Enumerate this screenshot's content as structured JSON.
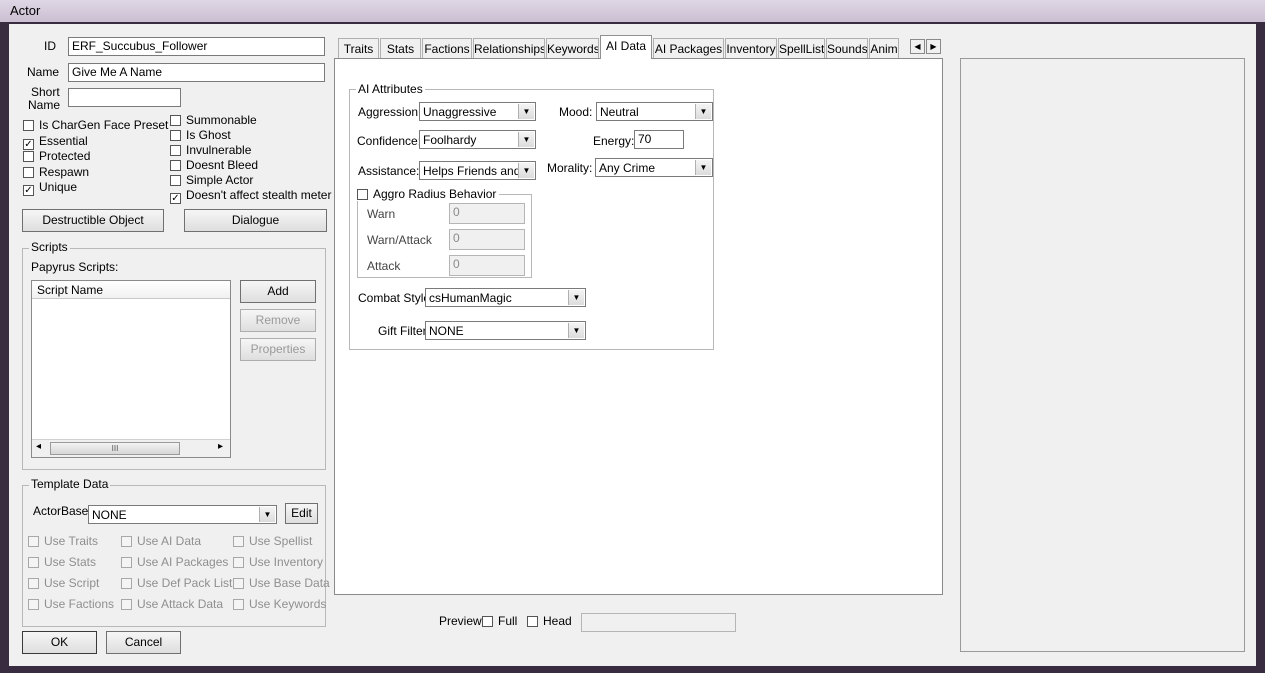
{
  "window": {
    "title": "Actor"
  },
  "fields": {
    "id_label": "ID",
    "id_value": "ERF_Succubus_Follower",
    "name_label": "Name",
    "name_value": "Give Me A Name",
    "short_name_label_1": "Short",
    "short_name_label_2": "Name",
    "short_name_value": ""
  },
  "flags_left": [
    {
      "label": "Is CharGen Face Preset",
      "checked": false
    },
    {
      "label": "Essential",
      "checked": true
    },
    {
      "label": "Protected",
      "checked": false
    },
    {
      "label": "Respawn",
      "checked": false
    },
    {
      "label": "Unique",
      "checked": true
    }
  ],
  "flags_right": [
    {
      "label": "Summonable",
      "checked": false
    },
    {
      "label": "Is Ghost",
      "checked": false
    },
    {
      "label": "Invulnerable",
      "checked": false
    },
    {
      "label": "Doesnt Bleed",
      "checked": false
    },
    {
      "label": "Simple Actor",
      "checked": false
    },
    {
      "label": "Doesn't affect stealth meter",
      "checked": true
    }
  ],
  "buttons": {
    "destructible": "Destructible Object",
    "dialogue": "Dialogue",
    "ok": "OK",
    "cancel": "Cancel"
  },
  "scripts": {
    "group_title": "Scripts",
    "papyrus_label": "Papyrus Scripts:",
    "column_header": "Script Name",
    "add": "Add",
    "remove": "Remove",
    "properties": "Properties",
    "scroll_grip": "III",
    "scroll_left": "◂",
    "scroll_right": "▸"
  },
  "template": {
    "group_title": "Template Data",
    "actorbase_label": "ActorBase",
    "actorbase_value": "NONE",
    "edit": "Edit",
    "options": [
      [
        "Use Traits",
        "Use AI Data",
        "Use Spellist"
      ],
      [
        "Use Stats",
        "Use AI Packages",
        "Use Inventory"
      ],
      [
        "Use Script",
        "Use Def Pack List",
        "Use Base Data"
      ],
      [
        "Use Factions",
        "Use Attack Data",
        "Use Keywords"
      ]
    ]
  },
  "tabs": [
    "Traits",
    "Stats",
    "Factions",
    "Relationships",
    "Keywords",
    "AI Data",
    "AI Packages",
    "Inventory",
    "SpellList",
    "Sounds",
    "Anim"
  ],
  "active_tab": "AI Data",
  "ai": {
    "group_title": "AI Attributes",
    "aggression_label": "Aggression:",
    "aggression_value": "Unaggressive",
    "mood_label": "Mood:",
    "mood_value": "Neutral",
    "confidence_label": "Confidence:",
    "confidence_value": "Foolhardy",
    "energy_label": "Energy:",
    "energy_value": "70",
    "assistance_label": "Assistance:",
    "assistance_value": "Helps Friends and A",
    "morality_label": "Morality:",
    "morality_value": "Any Crime",
    "aggro_label": "Aggro Radius Behavior",
    "warn_label": "Warn",
    "warn_value": "0",
    "warn_attack_label": "Warn/Attack",
    "warn_attack_value": "0",
    "attack_label": "Attack",
    "attack_value": "0",
    "combat_label": "Combat Style",
    "combat_value": "csHumanMagic",
    "gift_label": "Gift Filter",
    "gift_value": "NONE"
  },
  "preview": {
    "label": "Preview",
    "full": "Full",
    "head": "Head"
  }
}
